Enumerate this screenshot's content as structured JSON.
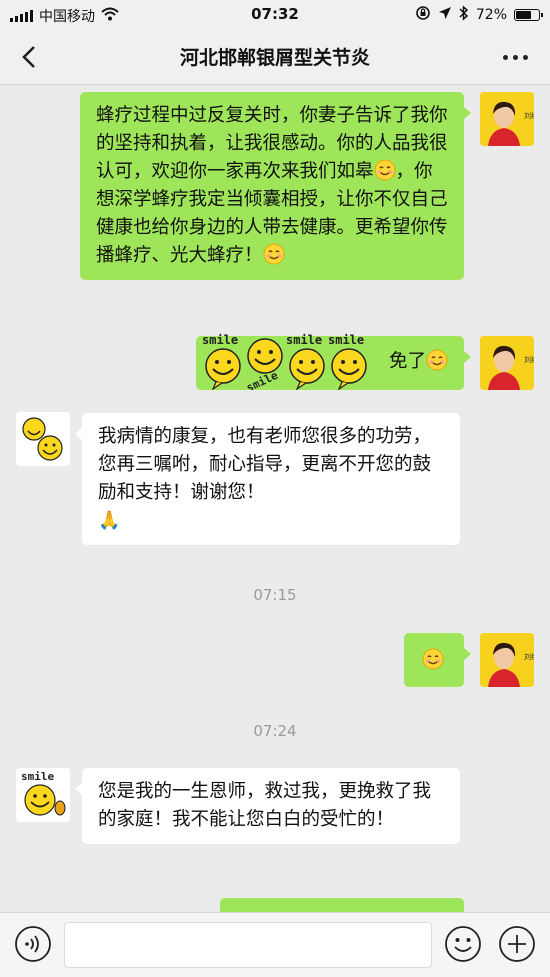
{
  "status_bar": {
    "carrier": "中国移动",
    "time": "07:32",
    "battery": "72%",
    "battery_level": 0.72
  },
  "nav": {
    "title": "河北邯郸银屑型关节炎"
  },
  "messages": [
    {
      "sender": "self",
      "text": "蜂疗过程中过反复关时，你妻子告诉了我你的坚持和执着，让我很感动。你的人品我很认可，欢迎你一家再次来我们如皋",
      "text_b": "，你想深学蜂疗我定当倾囊相授，让你不仅自己健康也给你身边的人带去健康。更希望你传播蜂疗、光大蜂疗！"
    },
    {
      "sender": "self",
      "text": "免了",
      "stickers": [
        "smile-sticker",
        "smile-sticker",
        "smile-sticker",
        "smile-sticker"
      ]
    },
    {
      "sender": "other",
      "text": "我病情的康复，也有老师您很多的功劳，您再三嘱咐，耐心指导，更离不开您的鼓励和支持！谢谢您！",
      "emoji": "🙏"
    },
    {
      "sender": "self",
      "emoji_only": true
    },
    {
      "sender": "other",
      "text": "您是我的一生恩师，救过我，更挽救了我的家庭！我不能让您白白的受忙的！"
    }
  ],
  "timestamps": [
    "07:15",
    "07:24"
  ],
  "sticker_word": "smile",
  "avatar_self": {
    "label": "刘红"
  },
  "input": {
    "placeholder": ""
  },
  "colors": {
    "self_bubble": "#9fe55a",
    "other_bubble": "#ffffff",
    "background": "#ebebeb"
  }
}
